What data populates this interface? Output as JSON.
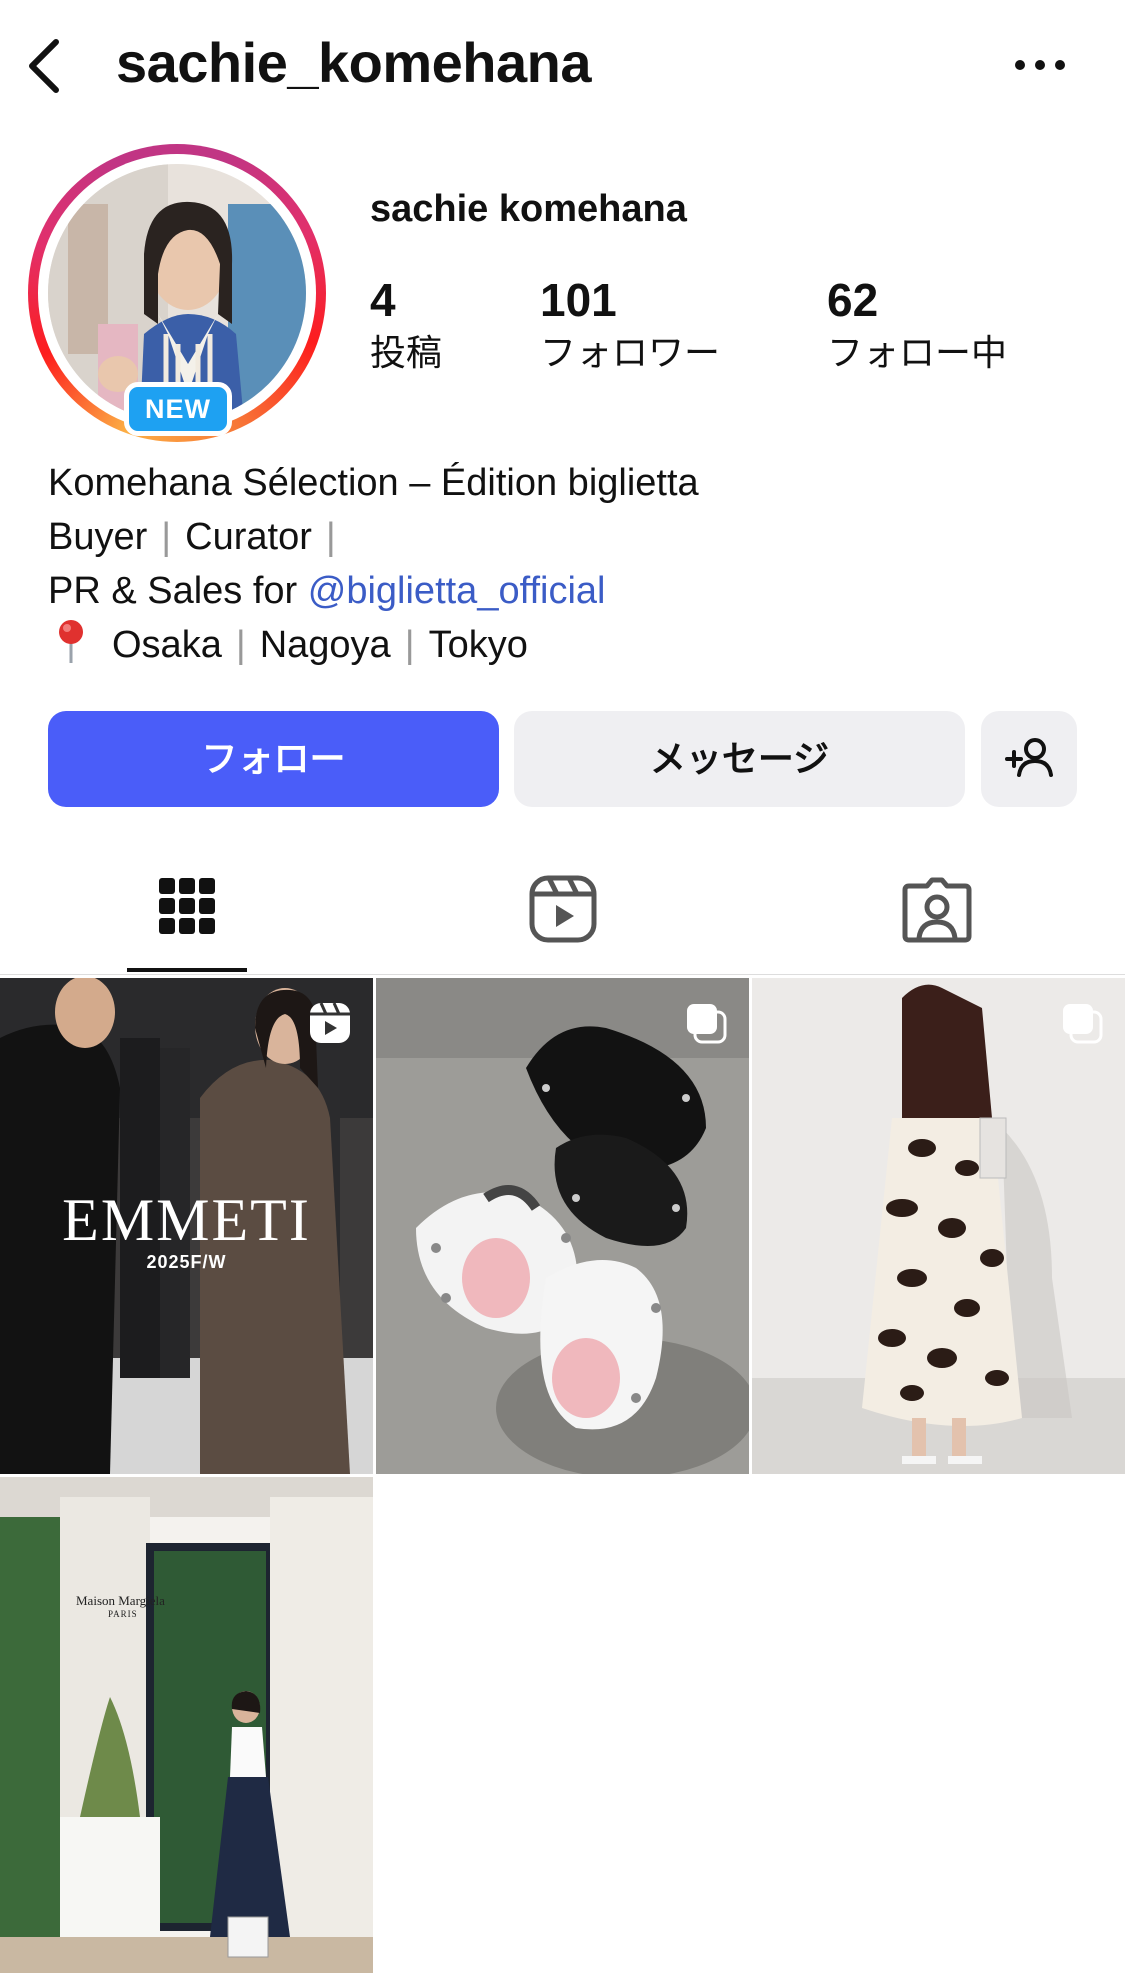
{
  "header": {
    "username": "sachie_komehana",
    "back_icon": "chevron-left-icon",
    "more_icon": "more-horizontal-icon"
  },
  "profile": {
    "full_name": "sachie komehana",
    "badge": "NEW",
    "stats": [
      {
        "value": "4",
        "label": "投稿"
      },
      {
        "value": "101",
        "label": "フォロワー"
      },
      {
        "value": "62",
        "label": "フォロー中"
      }
    ],
    "bio": {
      "line1": "Komehana Sélection – Édition biglietta",
      "line2_a": "Buyer",
      "line2_b": "Curator",
      "line3_prefix": "PR & Sales for ",
      "line3_mention": "@biglietta_official",
      "loc_1": "Osaka",
      "loc_2": "Nagoya",
      "loc_3": "Tokyo",
      "separator": "|"
    }
  },
  "actions": {
    "follow": "フォロー",
    "message": "メッセージ",
    "add_icon": "add-person-icon"
  },
  "tabs": [
    "grid-icon",
    "reels-icon",
    "tagged-icon"
  ],
  "colors": {
    "follow_button": "#4a5df9",
    "secondary_button": "#efeff2",
    "mention": "#3b5cc6",
    "new_badge": "#1ea1f2"
  },
  "posts": [
    {
      "type": "reel",
      "overlay_title": "EMMETI",
      "overlay_subtitle": "2025F/W"
    },
    {
      "type": "carousel"
    },
    {
      "type": "carousel"
    },
    {
      "type": "photo",
      "sign_text": "Maison Margiela",
      "sign_subtext": "PARIS"
    }
  ]
}
